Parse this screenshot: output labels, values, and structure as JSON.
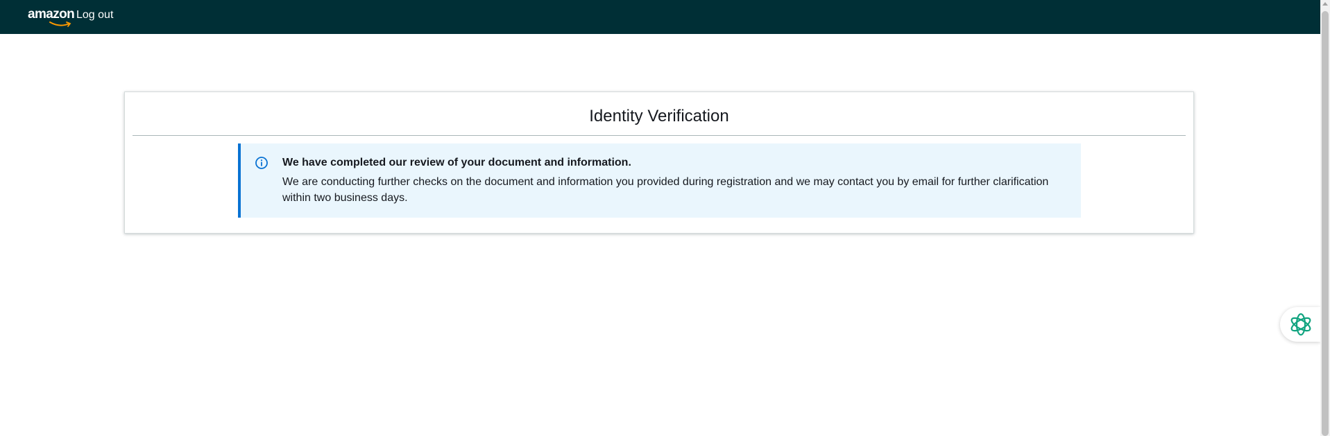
{
  "header": {
    "logo_text": "amazon",
    "logout_label": "Log out",
    "background_color": "#002f36",
    "logo_smile_color": "#ff9900"
  },
  "card": {
    "title": "Identity Verification"
  },
  "alert": {
    "icon": "info-icon",
    "title": "We have completed our review of your document and information.",
    "body": "We are conducting further checks on the document and information you provided during registration and we may contact you by email for further clarification within two business days.",
    "accent_color": "#0972d3",
    "background_color": "#eaf6fd"
  },
  "assistant": {
    "icon": "assistant-flower-icon",
    "color": "#10a37f"
  }
}
